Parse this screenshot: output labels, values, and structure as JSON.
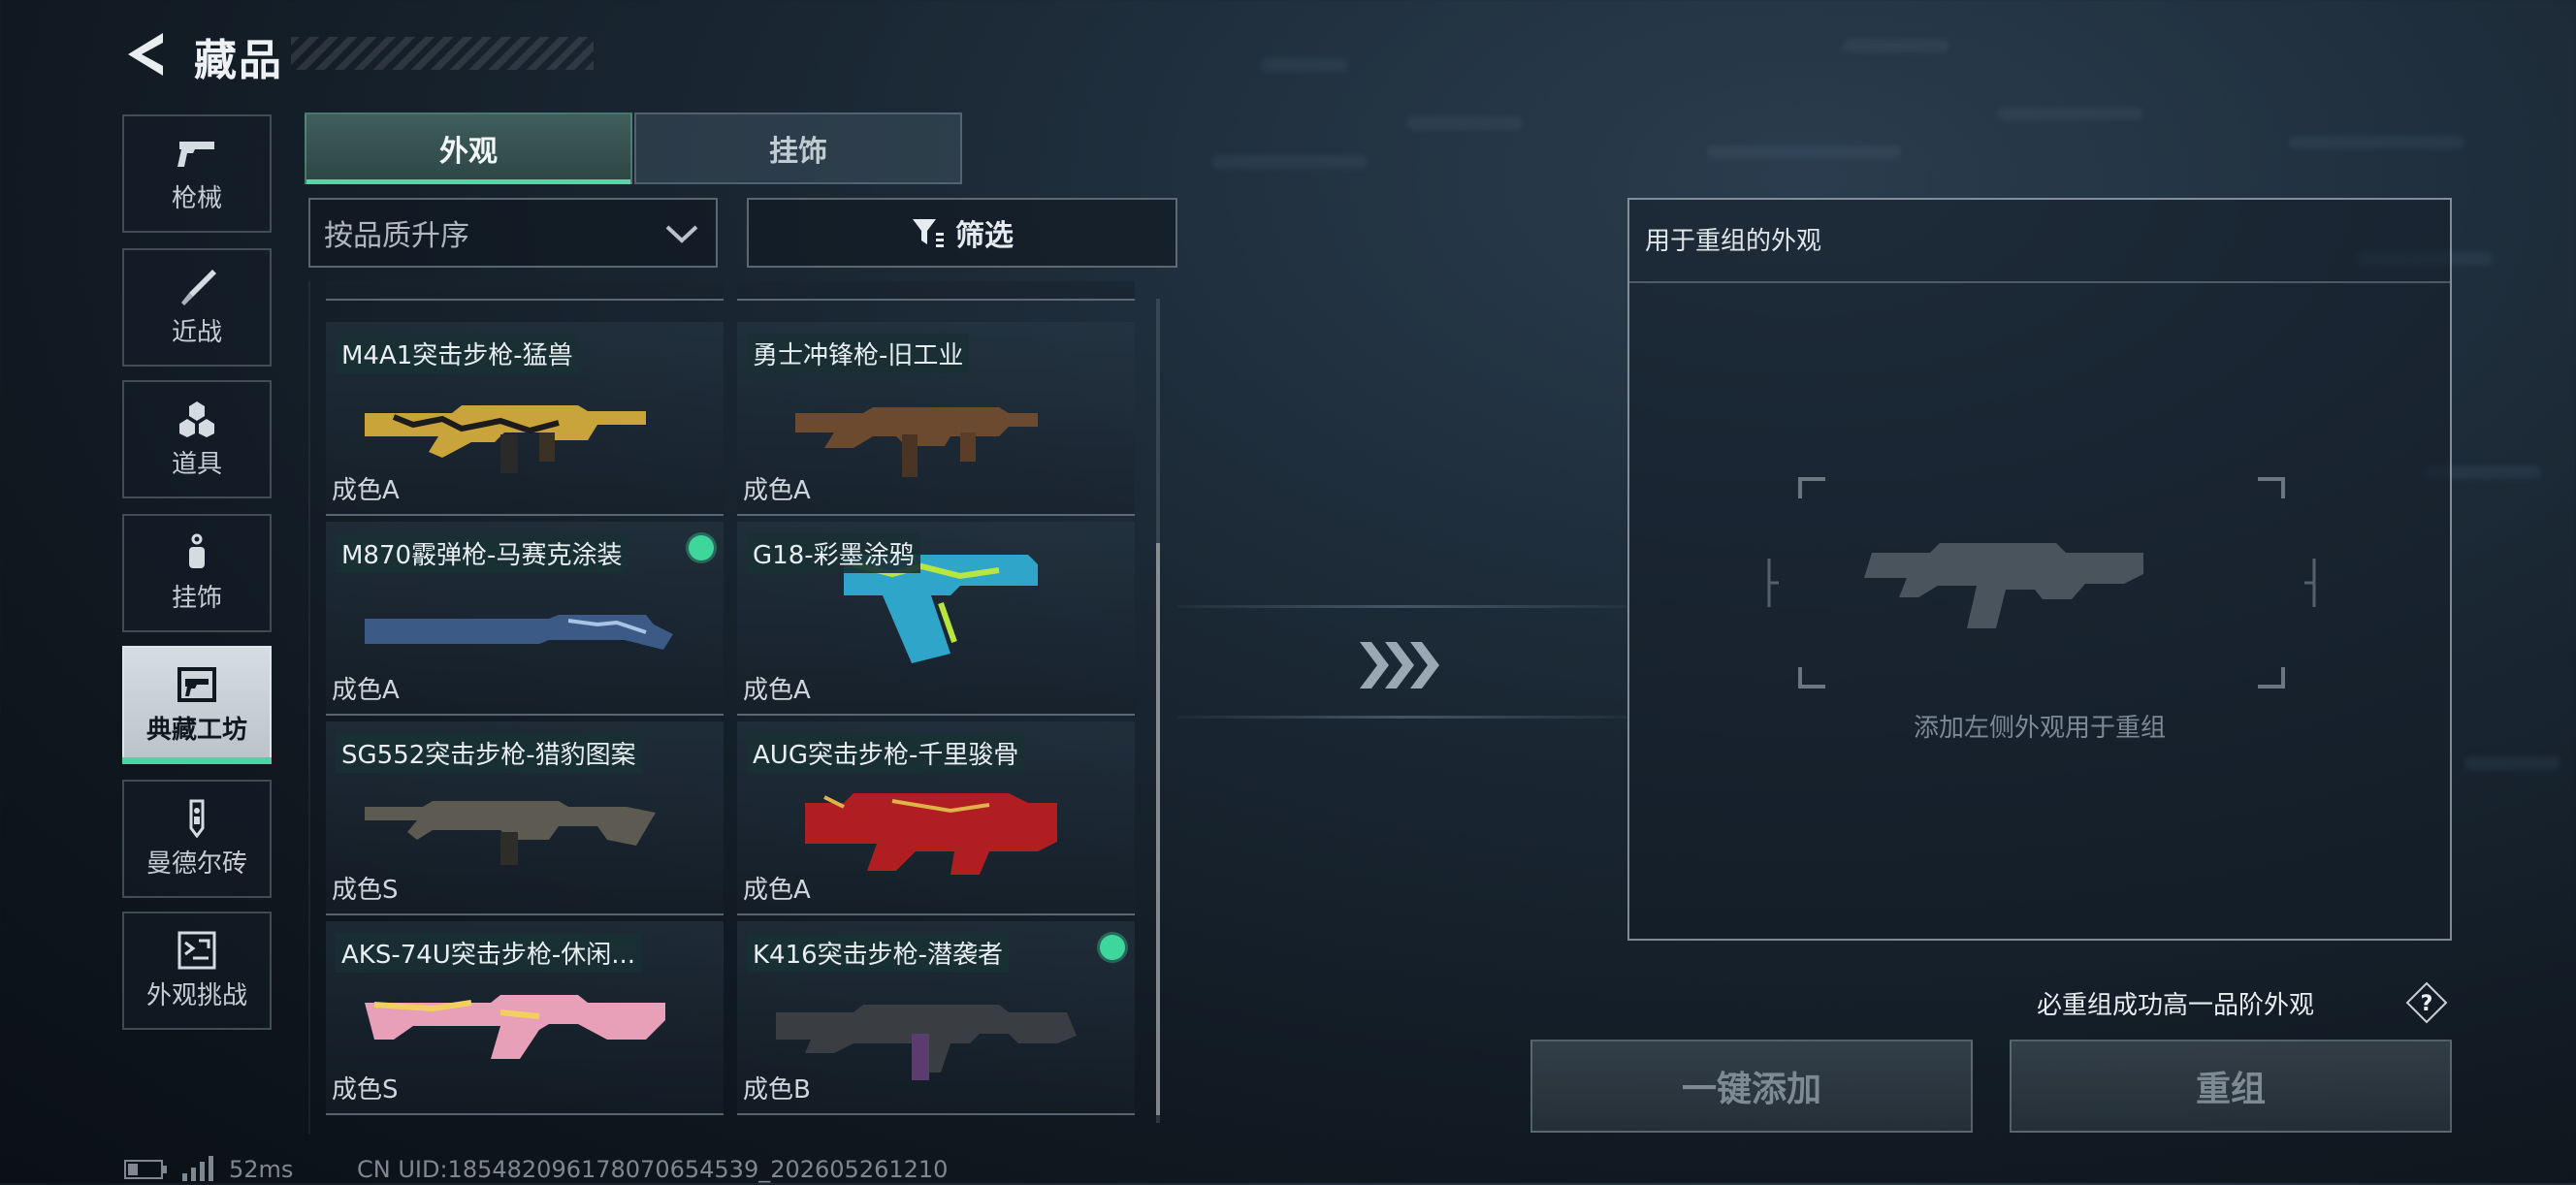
{
  "header": {
    "title": "藏品"
  },
  "sidebar": {
    "items": [
      {
        "label": "枪械",
        "icon": "pistol-icon"
      },
      {
        "label": "近战",
        "icon": "knife-icon"
      },
      {
        "label": "道具",
        "icon": "grenade-icon"
      },
      {
        "label": "挂饰",
        "icon": "charm-icon"
      },
      {
        "label": "典藏工坊",
        "icon": "gun-frame-icon",
        "active": true
      },
      {
        "label": "曼德尔砖",
        "icon": "brick-icon"
      },
      {
        "label": "外观挑战",
        "icon": "challenge-icon"
      }
    ]
  },
  "tabs": [
    {
      "label": "外观",
      "active": true
    },
    {
      "label": "挂饰",
      "active": false
    }
  ],
  "sort": {
    "label": "按品质升序"
  },
  "filter": {
    "label": "筛选"
  },
  "items": [
    {
      "name": "M4A1突击步枪-猛兽",
      "grade": "成色A",
      "tag": false
    },
    {
      "name": "勇士冲锋枪-旧工业",
      "grade": "成色A",
      "tag": false
    },
    {
      "name": "M870霰弹枪-马赛克涂装",
      "grade": "成色A",
      "tag": true
    },
    {
      "name": "G18-彩墨涂鸦",
      "grade": "成色A",
      "tag": false
    },
    {
      "name": "SG552突击步枪-猎豹图案",
      "grade": "成色S",
      "tag": false
    },
    {
      "name": "AUG突击步枪-千里骏骨",
      "grade": "成色A",
      "tag": false
    },
    {
      "name": "AKS-74U突击步枪-休闲...",
      "grade": "成色S",
      "tag": false
    },
    {
      "name": "K416突击步枪-潜袭者",
      "grade": "成色B",
      "tag": true
    }
  ],
  "panel": {
    "title": "用于重组的外观",
    "hint": "添加左侧外观用于重组",
    "guarantee": "必重组成功高一品阶外观",
    "help_icon": "question-icon"
  },
  "buttons": {
    "add_all": "一键添加",
    "recombine": "重组"
  },
  "status": {
    "ping": "52ms",
    "uid": "CN UID:185482096178070654539_202605261210"
  },
  "colors": {
    "accent": "#49d6a4",
    "tag": "#3fd69c"
  }
}
